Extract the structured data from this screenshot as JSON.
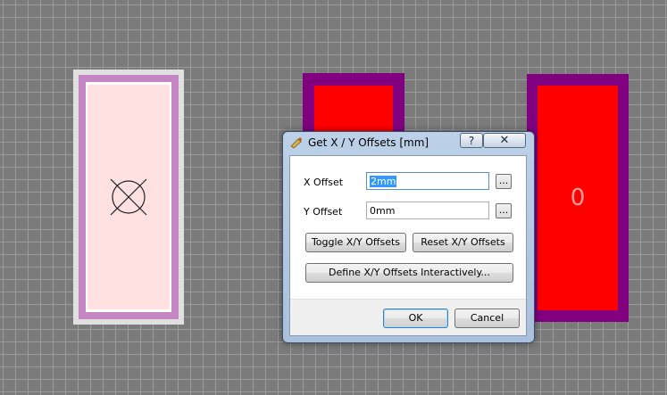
{
  "canvas": {
    "pad_right_label": "0"
  },
  "dialog": {
    "title": "Get X / Y Offsets [mm]",
    "help_label": "?",
    "close_label": "✕",
    "x_offset_label": "X Offset",
    "x_offset_value": "2mm",
    "y_offset_label": "Y Offset",
    "y_offset_value": "0mm",
    "x_pick_label": "...",
    "y_pick_label": "...",
    "toggle_label": "Toggle X/Y Offsets",
    "reset_label": "Reset X/Y Offsets",
    "define_label": "Define X/Y Offsets Interactively...",
    "ok_label": "OK",
    "cancel_label": "Cancel"
  },
  "colors": {
    "pad_outline": "#800080",
    "pad_fill": "#ff0000",
    "selected_pad_fill": "#ffe1e1",
    "selected_pad_outline": "#c487c4"
  }
}
